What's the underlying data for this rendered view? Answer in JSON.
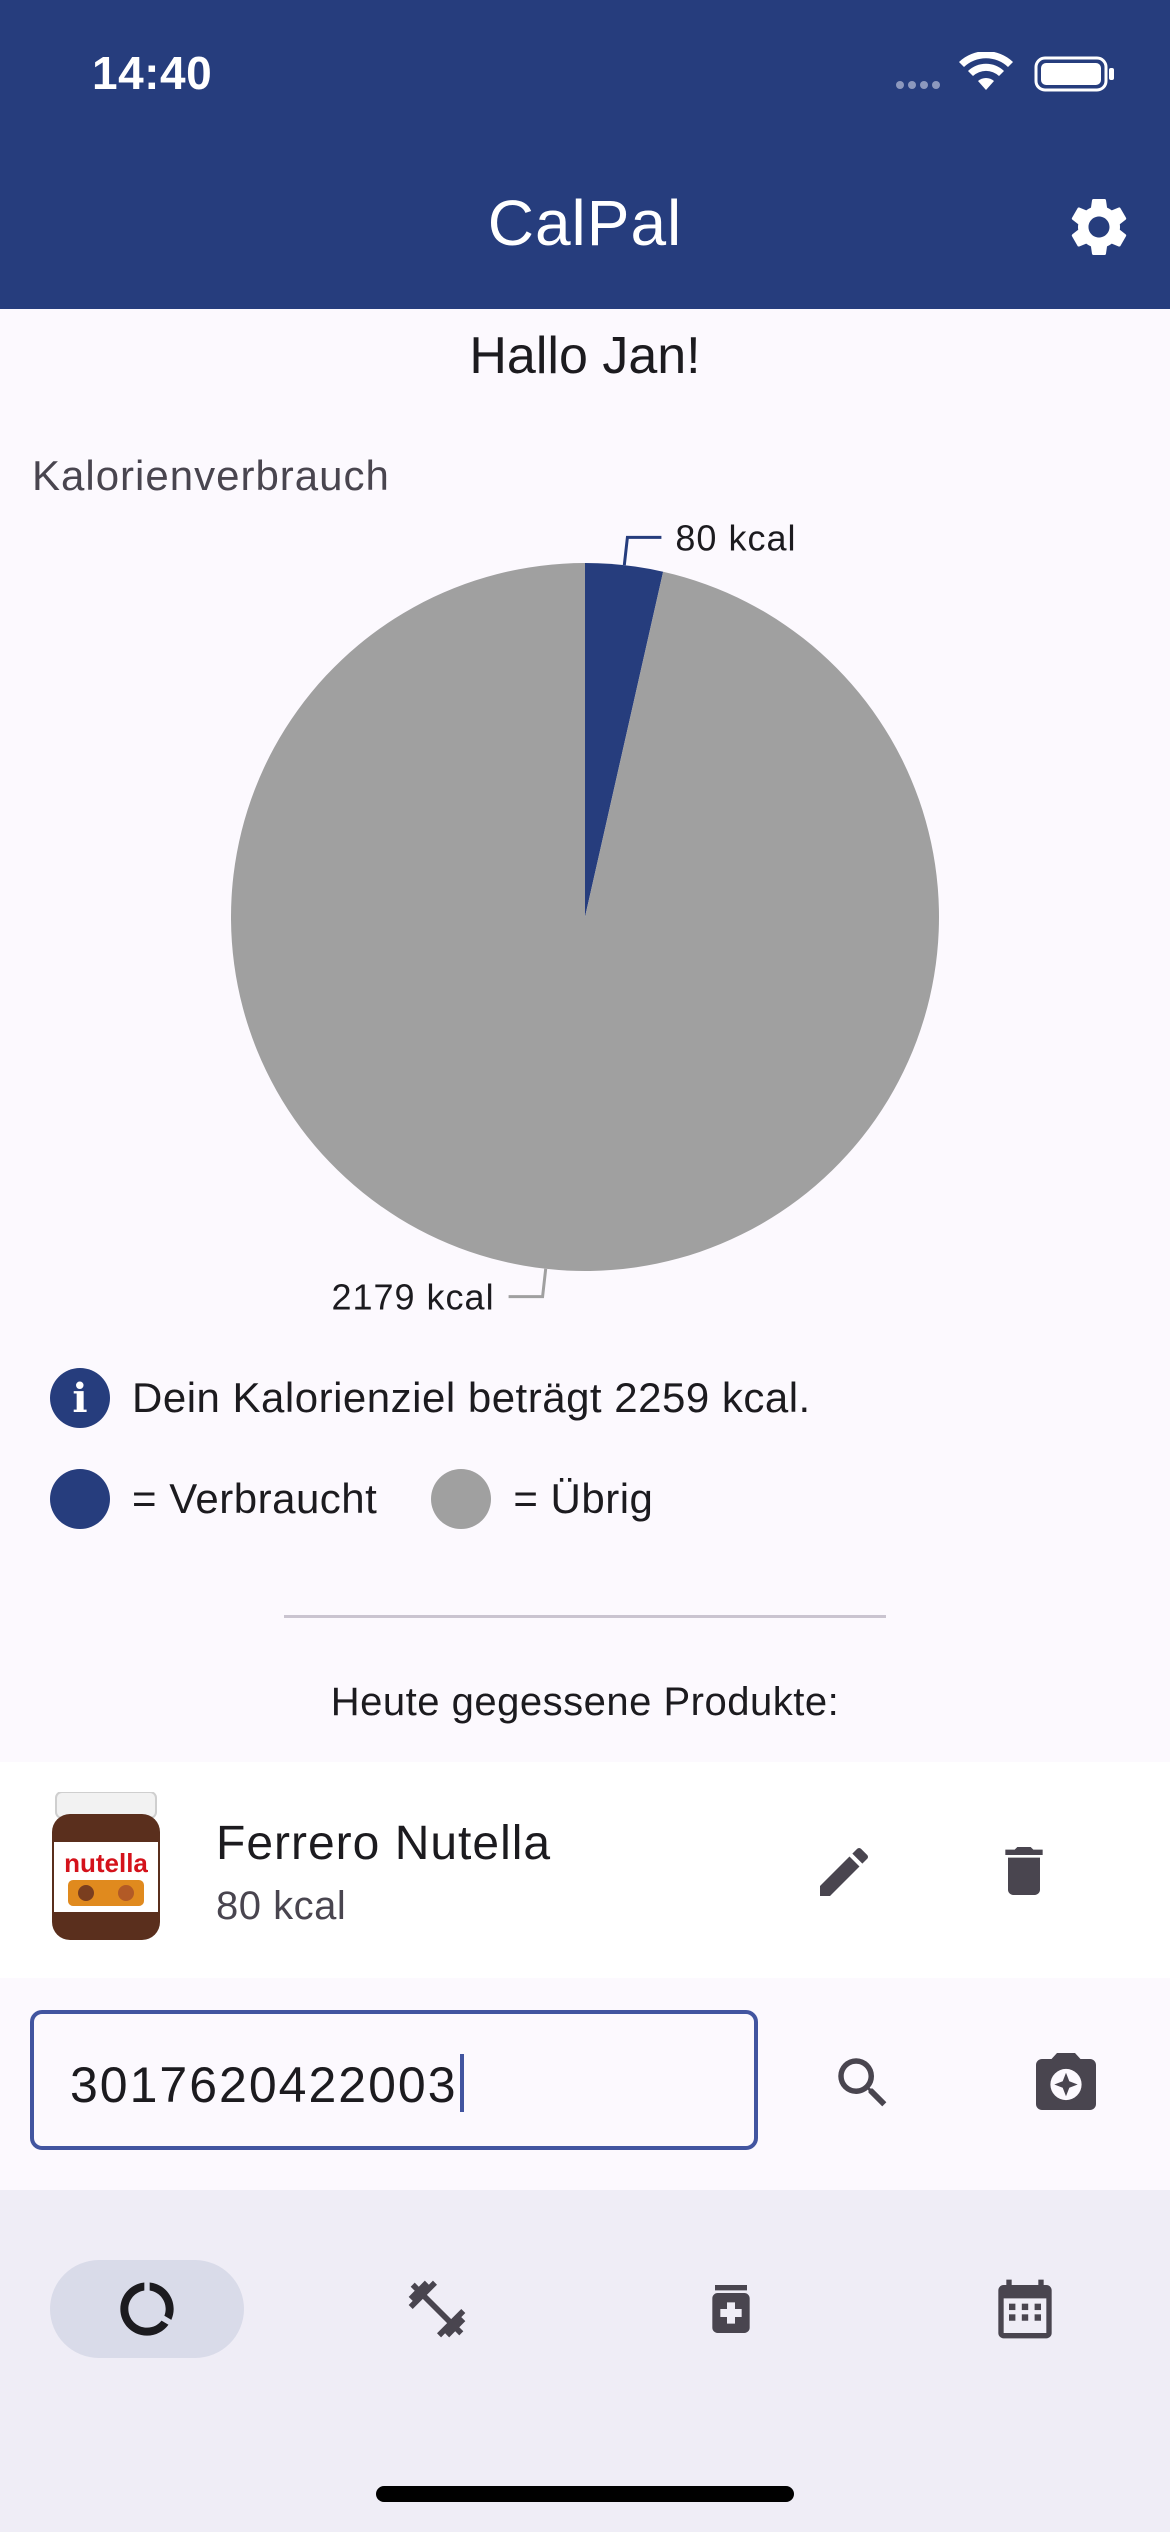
{
  "status_bar": {
    "time": "14:40"
  },
  "app_bar": {
    "title": "CalPal"
  },
  "greeting": "Hallo Jan!",
  "chart_section": {
    "title": "Kalorienverbrauch"
  },
  "chart_data": {
    "type": "pie",
    "title": "Kalorienverbrauch",
    "slices": [
      {
        "label": "Verbraucht",
        "value": 80,
        "data_label": "80 kcal",
        "color": "#263d7d"
      },
      {
        "label": "Übrig",
        "value": 2179,
        "data_label": "2179 kcal",
        "color": "#a0a0a0"
      }
    ]
  },
  "info": {
    "text": "Dein Kalorienziel beträgt 2259 kcal."
  },
  "legend": {
    "consumed": {
      "label": "= Verbraucht",
      "color": "#263d7d"
    },
    "remaining": {
      "label": "= Übrig",
      "color": "#a0a0a0"
    }
  },
  "list": {
    "title": "Heute gegessene Produkte:"
  },
  "products": [
    {
      "name": "Ferrero Nutella",
      "kcal": "80 kcal",
      "image_text": "nutella"
    }
  ],
  "search": {
    "value": "3017620422003"
  },
  "bottom_nav": {
    "items": [
      {
        "icon": "donut-chart-icon",
        "active": true
      },
      {
        "icon": "dumbbell-icon",
        "active": false
      },
      {
        "icon": "medication-icon",
        "active": false
      },
      {
        "icon": "calendar-icon",
        "active": false
      }
    ]
  },
  "colors": {
    "primary": "#263d7d",
    "remaining": "#a0a0a0",
    "background": "#fcf9fe",
    "nav_background": "#efedf6"
  }
}
